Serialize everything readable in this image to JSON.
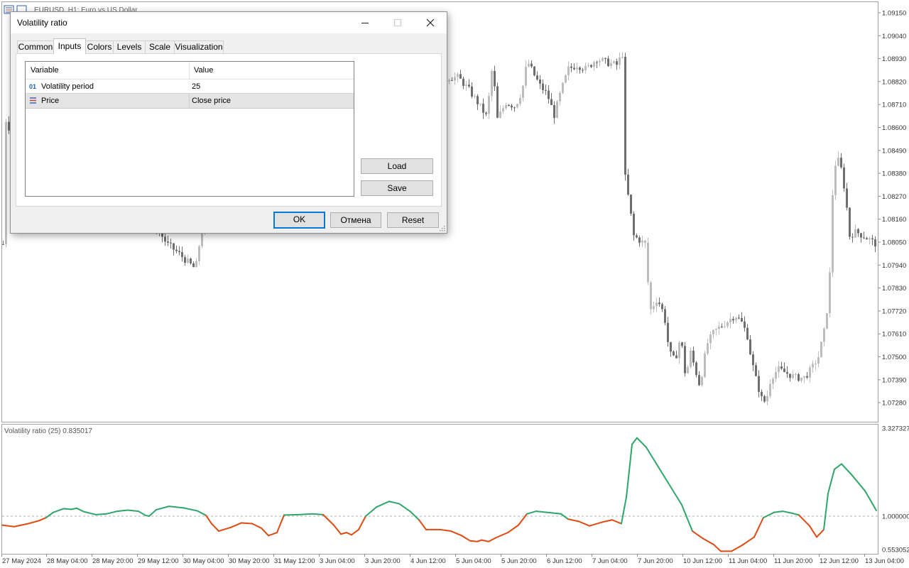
{
  "window": {
    "chart_title": "EURUSD, H1:  Euro vs US Dollar"
  },
  "price_axis": {
    "labels": [
      "1.09150",
      "1.09040",
      "1.08930",
      "1.08820",
      "1.08710",
      "1.08600",
      "1.08490",
      "1.08380",
      "1.08270",
      "1.08160",
      "1.08050",
      "1.07940",
      "1.07830",
      "1.07720",
      "1.07610",
      "1.07500",
      "1.07390",
      "1.07280"
    ]
  },
  "subwindow": {
    "title": "Volatility ratio (25) 0.835017",
    "axis_labels": [
      "3.327327",
      "1.000000",
      "0.553052"
    ]
  },
  "time_axis": {
    "labels": [
      "27 May 2024",
      "28 May 04:00",
      "28 May 20:00",
      "29 May 12:00",
      "30 May 04:00",
      "30 May 20:00",
      "31 May 12:00",
      "3 Jun 04:00",
      "3 Jun 20:00",
      "4 Jun 12:00",
      "5 Jun 04:00",
      "5 Jun 20:00",
      "6 Jun 12:00",
      "7 Jun 04:00",
      "7 Jun 20:00",
      "10 Jun 12:00",
      "11 Jun 04:00",
      "11 Jun 20:00",
      "12 Jun 12:00",
      "13 Jun 04:00"
    ]
  },
  "colors": {
    "candle_dark": "#6e6e6e",
    "candle_light": "#bdbdbd",
    "vr_up": "#2ea66a",
    "vr_down": "#e04a10",
    "accent": "#0078d7"
  },
  "dialog": {
    "title": "Volatility ratio",
    "minimize_icon": "minimize-icon",
    "maximize_icon": "maximize-icon",
    "close_icon": "close-icon",
    "tabs": [
      "Common",
      "Inputs",
      "Colors",
      "Levels",
      "Scale",
      "Visualization"
    ],
    "active_tab": "Inputs",
    "grid": {
      "col_variable": "Variable",
      "col_value": "Value",
      "rows": [
        {
          "icon": "01",
          "variable": "Volatility period",
          "value": "25"
        },
        {
          "icon": "price-icon",
          "variable": "Price",
          "value": "Close price"
        }
      ]
    },
    "buttons": {
      "load": "Load",
      "save": "Save",
      "ok": "OK",
      "cancel": "Отмена",
      "reset": "Reset"
    }
  }
}
